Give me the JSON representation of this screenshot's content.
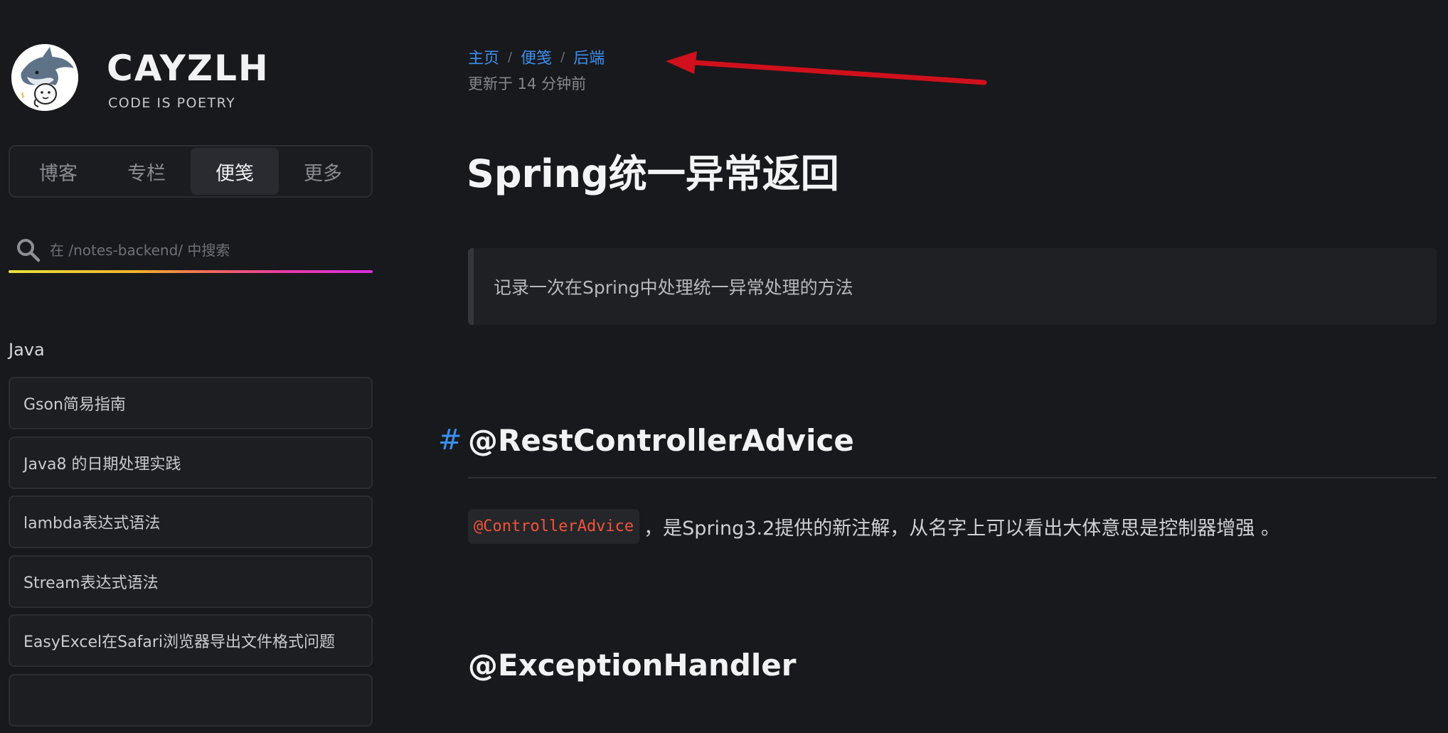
{
  "brand": {
    "title": "CAYZLH",
    "subtitle": "CODE IS POETRY"
  },
  "nav": {
    "tabs": [
      {
        "label": "博客",
        "active": false
      },
      {
        "label": "专栏",
        "active": false
      },
      {
        "label": "便笺",
        "active": true
      },
      {
        "label": "更多",
        "active": false
      }
    ]
  },
  "search": {
    "placeholder": "在 /notes-backend/ 中搜索",
    "value": ""
  },
  "sidebar": {
    "section_title": "Java",
    "items": [
      {
        "label": "Gson简易指南"
      },
      {
        "label": "Java8 的日期处理实践"
      },
      {
        "label": "lambda表达式语法"
      },
      {
        "label": "Stream表达式语法"
      },
      {
        "label": "EasyExcel在Safari浏览器导出文件格式问题"
      }
    ]
  },
  "breadcrumb": {
    "home": "主页",
    "notes": "便笺",
    "backend": "后端",
    "separator": "/"
  },
  "updated": "更新于 14 分钟前",
  "article": {
    "title": "Spring统一异常返回",
    "summary": "记录一次在Spring中处理统一异常处理的方法",
    "anchor": "#",
    "h2_first": "@RestControllerAdvice",
    "code_inline": "@ControllerAdvice",
    "para_text": "，是Spring3.2提供的新注解，从名字上可以看出大体意思是控制器增强 。",
    "h2_second": "@ExceptionHandler"
  },
  "colors": {
    "background": "#18191c",
    "link": "#3b8ff0",
    "code": "#f0533c",
    "arrow": "#d0101c"
  }
}
